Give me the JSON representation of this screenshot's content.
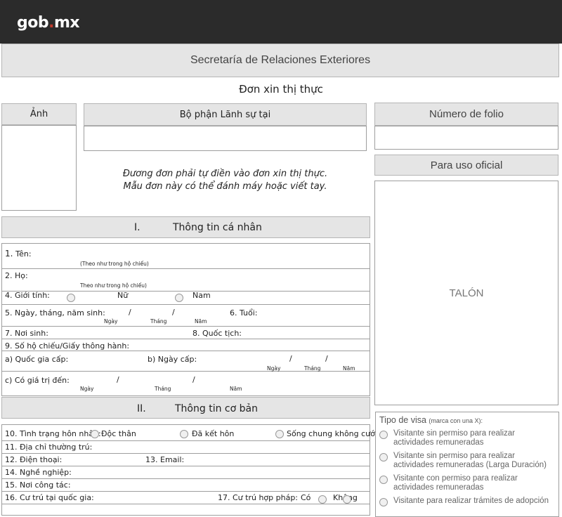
{
  "header": {
    "logo_main": "gob",
    "logo_dot": ".",
    "logo_tail": "mx"
  },
  "ministry": "Secretaría de Relaciones Exteriores",
  "form_title": "Đơn xin thị thực",
  "photo_label": "Ảnh",
  "consular_label": "Bộ phận Lãnh sự tại",
  "folio_label": "Número de folio",
  "official_label": "Para uso oficial",
  "talon": "TALÓN",
  "instructions": {
    "line1": "Đương đơn phải tự điền vào đơn xin thị thực.",
    "line2": "Mẫu đơn này có thể đánh máy hoặc viết tay."
  },
  "section1": {
    "num": "I.",
    "title": "Thông tin cá nhân"
  },
  "section2": {
    "num": "II.",
    "title": "Thông tin cơ bản"
  },
  "fields": {
    "ten": "Tên:",
    "ten_num": "1.",
    "ten_note": "(Theo như  trong hộ chiếu)",
    "ho": "2. Họ:",
    "ho_note": "Theo như trong hộ chiếu)",
    "gioi_tinh": "4. Giới tính:",
    "nu": "Nữ",
    "nam": "Nam",
    "ngay_sinh": "5. Ngày, tháng, năm sinh:",
    "slash": "/",
    "tuoi": "6. Tuổi:",
    "ngay": "Ngày",
    "thang": "Tháng",
    "nam_y": "Năm",
    "noi_sinh": "7. Nơi sinh:",
    "quoc_tich": "8. Quốc tịch:",
    "ho_chieu": "9. Số hộ chiếu/Giấy thông hành:",
    "quoc_gia_cap": "a) Quốc gia cấp:",
    "ngay_cap": "b) Ngày cấp:",
    "gia_tri": "c) Có giá trị đến:",
    "hon_nhan": "10. Tình trạng hôn nhân:",
    "doc_than": "Độc thân",
    "da_ket_hon": "Đã kết hôn",
    "song_chung": "Sống chung không cưới",
    "dia_chi": "11. Địa chỉ thường trú:",
    "dien_thoai": "12. Điện thoại:",
    "email": "13. Email:",
    "nghe_nghiep": "14. Nghề nghiệp:",
    "noi_cong_tac": "15. Nơi công tác:",
    "cu_tru": "16. Cư trú tại quốc gia:",
    "cu_tru_hop_phap": "17. Cư trú hợp pháp:",
    "co": "Có",
    "khong": "Không"
  },
  "visa": {
    "title": "Tipo de visa",
    "title_note": "(marca con una X):",
    "options": [
      "Visitante sin permiso para realizar actividades remuneradas",
      "Visitante sin permiso para realizar actividades remuneradas (Larga Duración)",
      "Visitante con permiso para realizar actividades remuneradas",
      "Visitante para realizar trámites de adopción"
    ]
  }
}
